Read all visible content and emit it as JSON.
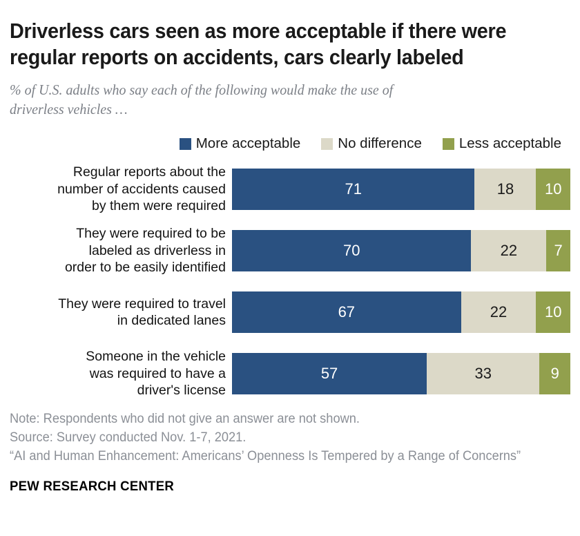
{
  "title": "Driverless cars seen as more acceptable if there were\nregular reports on accidents, cars clearly labeled",
  "subtitle": "% of U.S. adults who say each of the following would make the use of\ndriverless vehicles …",
  "legend": [
    {
      "label": "More acceptable",
      "color": "#2a5181",
      "key": "more"
    },
    {
      "label": "No difference",
      "color": "#dcd9c8",
      "key": "no"
    },
    {
      "label": "Less acceptable",
      "color": "#92a04d",
      "key": "less"
    }
  ],
  "footer": {
    "note": "Note: Respondents who did not give an answer are not shown.",
    "source": "Source: Survey conducted Nov. 1-7, 2021.",
    "report": "“AI and Human Enhancement: Americans’ Openness Is Tempered by a Range of Concerns”",
    "brand": "PEW RESEARCH CENTER"
  },
  "chart_data": {
    "type": "bar",
    "orientation": "horizontal",
    "stacked": true,
    "normalized": true,
    "title": "Driverless cars seen as more acceptable if there were regular reports on accidents, cars clearly labeled",
    "subtitle": "% of U.S. adults who say each of the following would make the use of driverless vehicles …",
    "xlabel": "",
    "ylabel": "",
    "grid": false,
    "legend_position": "top-right",
    "categories": [
      "Regular reports about the\nnumber of accidents caused\nby them were required",
      "They were required to be\nlabeled as driverless in\norder to be easily identified",
      "They were required to travel\nin dedicated lanes",
      "Someone in the vehicle\nwas required to have a\ndriver's license"
    ],
    "series": [
      {
        "name": "More acceptable",
        "color": "#2a5181",
        "values": [
          71,
          70,
          67,
          57
        ]
      },
      {
        "name": "No difference",
        "color": "#dcd9c8",
        "values": [
          18,
          22,
          22,
          33
        ]
      },
      {
        "name": "Less acceptable",
        "color": "#92a04d",
        "values": [
          10,
          7,
          10,
          9
        ]
      }
    ],
    "rows": [
      {
        "label": "Regular reports about the\nnumber of accidents caused\nby them were required",
        "more": 71,
        "no": 18,
        "less": 10,
        "total": 99
      },
      {
        "label": "They were required to be\nlabeled as driverless in\norder to be easily identified",
        "more": 70,
        "no": 22,
        "less": 7,
        "total": 99
      },
      {
        "label": "They were required to travel\nin dedicated lanes",
        "more": 67,
        "no": 22,
        "less": 10,
        "total": 99
      },
      {
        "label": "Someone in the vehicle\nwas required to have a\ndriver's license",
        "more": 57,
        "no": 33,
        "less": 9,
        "total": 99
      }
    ]
  }
}
